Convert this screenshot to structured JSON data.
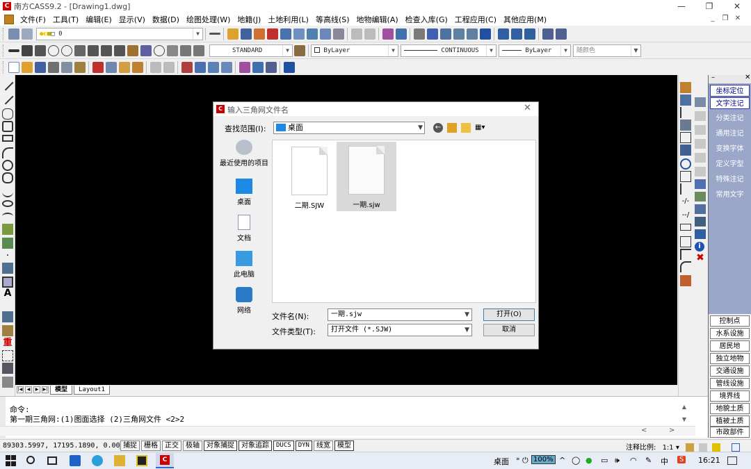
{
  "window": {
    "title": "南方CASS9.2 - [Drawing1.dwg]",
    "logo": "C"
  },
  "menu": [
    "文件(F)",
    "工具(T)",
    "编辑(E)",
    "显示(V)",
    "数据(D)",
    "绘图处理(W)",
    "地籍(J)",
    "土地利用(L)",
    "等高线(S)",
    "地物编辑(A)",
    "检查入库(G)",
    "工程应用(C)",
    "其他应用(M)"
  ],
  "toolbar1": {
    "layer_value": "0"
  },
  "toolbar2": {
    "textstyle": "STANDARD",
    "color": "ByLayer",
    "linetype": "CONTINUOUS",
    "lineweight": "ByLayer",
    "plotstyle": "随颜色"
  },
  "layout_tabs": [
    "模型",
    "Layout1"
  ],
  "layout_nav": [
    "|◀",
    "◀",
    "▶",
    "▶|"
  ],
  "right_panel": {
    "top_buttons": [
      "坐标定位",
      "文字注记",
      "分类注记",
      "通用注记",
      "变换字体",
      "定义字型",
      "特殊注记",
      "常用文字"
    ],
    "bottom_buttons": [
      "控制点",
      "水系设施",
      "居民地",
      "独立地物",
      "交通设施",
      "管线设施",
      "境界线",
      "地貌土质",
      "植被土质",
      "市政部件"
    ]
  },
  "command": {
    "line1": "命令:",
    "line2": "第一期三角网:(1)图面选择 (2)三角网文件 <2>2"
  },
  "status": {
    "coords": "89303.5997, 17195.1890, 0.0000",
    "toggles": [
      "捕捉",
      "栅格",
      "正交",
      "极轴",
      "对象捕捉",
      "对象追踪",
      "DUCS",
      "DYN",
      "线宽",
      "模型"
    ],
    "annotation_scale_label": "注释比例:",
    "annotation_scale_value": "1:1"
  },
  "taskbar": {
    "location": "桌面",
    "battery": "100%",
    "time": "16:21"
  },
  "dialog": {
    "title": "输入三角网文件名",
    "look_in_label": "查找范围(I):",
    "look_in_value": "桌面",
    "places": [
      "最近使用的项目",
      "桌面",
      "文档",
      "此电脑",
      "网络"
    ],
    "files": [
      {
        "name": "二期.SJW",
        "selected": false
      },
      {
        "name": "一期.sjw",
        "selected": true
      }
    ],
    "filename_label": "文件名(N):",
    "filename_value": "一期.sjw",
    "filetype_label": "文件类型(T):",
    "filetype_value": "打开文件 (*.SJW)",
    "open_button": "打开(O)",
    "cancel_button": "取消"
  },
  "colors": {
    "canvas": "#000000",
    "panel_bg": "#9aa7c8",
    "dialog_bg": "#f0f0f0",
    "accent_blue": "#1e88e5",
    "logo_red": "#cc0000"
  }
}
